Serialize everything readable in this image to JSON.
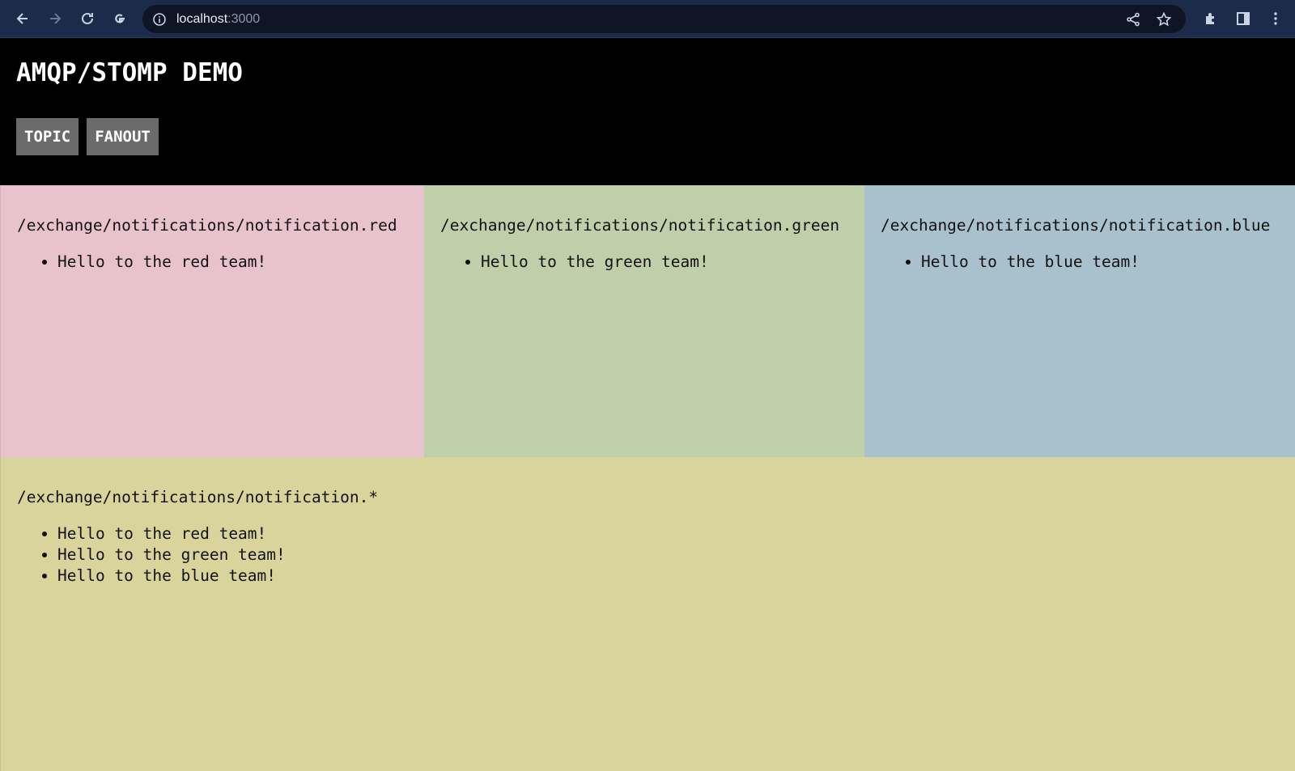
{
  "browser": {
    "url_host": "localhost",
    "url_port": ":3000"
  },
  "app": {
    "title": "AMQP/STOMP DEMO",
    "buttons": [
      "TOPIC",
      "FANOUT"
    ]
  },
  "panels": {
    "red": {
      "topic": "/exchange/notifications/notification.red",
      "messages": [
        "Hello to the red team!"
      ],
      "color": "#e8c3cd"
    },
    "green": {
      "topic": "/exchange/notifications/notification.green",
      "messages": [
        "Hello to the green team!"
      ],
      "color": "#bfcfaa"
    },
    "blue": {
      "topic": "/exchange/notifications/notification.blue",
      "messages": [
        "Hello to the blue team!"
      ],
      "color": "#a9c0cd"
    },
    "all": {
      "topic": "/exchange/notifications/notification.*",
      "messages": [
        "Hello to the red team!",
        "Hello to the green team!",
        "Hello to the blue team!"
      ],
      "color": "#d9d49c"
    }
  }
}
